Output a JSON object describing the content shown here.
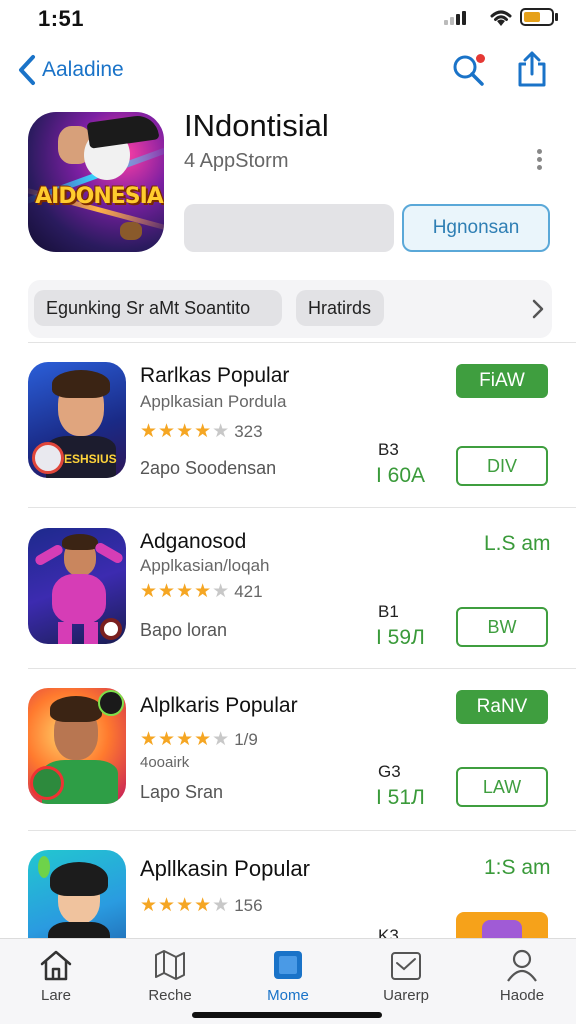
{
  "status_bar": {
    "time": "1:51"
  },
  "nav": {
    "back_label": "Aaladine"
  },
  "hero": {
    "icon_text": "AIDONESIA",
    "title": "INdontisial",
    "subtitle": "4 AppStorm",
    "secondary_button": "Hgnonsan"
  },
  "chips": {
    "items": [
      "Egunking Sr  aMt Soantito",
      "Hratirds"
    ]
  },
  "apps": [
    {
      "name": "Rarlkas Popular",
      "subtitle": "Applkasian Pordula",
      "rating": 4,
      "rating_count": "323",
      "meta": "2apo Soodensan",
      "icon_badge": "ESHSIUS",
      "size_top": "B3",
      "size": "I 60A",
      "top_button": "FiAW",
      "bottom_button": "DIV"
    },
    {
      "name": "Adganosod",
      "subtitle": "Applkasian/loqah",
      "rating": 4,
      "rating_count": "421",
      "meta": "Bapo loran",
      "size_top": "B1",
      "size": "I 59Л",
      "top_label": "L.S am",
      "bottom_button": "BW"
    },
    {
      "name": "Alplkaris Popular",
      "subtitle": "4ooairk",
      "rating": 4,
      "rating_count": "1/9",
      "meta": "Lapo Sran",
      "size_top": "G3",
      "size": "I 51Л",
      "top_button": "RaNV",
      "bottom_button": "LAW"
    },
    {
      "name": "Apllkasin Popular",
      "rating": 4,
      "rating_count": "156",
      "size_top": "K3",
      "top_label": "1:S am"
    }
  ],
  "tabs": [
    {
      "label": "Lare",
      "icon": "home-icon"
    },
    {
      "label": "Reche",
      "icon": "map-icon"
    },
    {
      "label": "Mome",
      "icon": "apps-icon",
      "active": true
    },
    {
      "label": "Uarerp",
      "icon": "mail-icon"
    },
    {
      "label": "Haode",
      "icon": "person-icon"
    }
  ],
  "colors": {
    "accent": "#1a73c8",
    "green": "#3f9e3f",
    "star": "#f5a623"
  }
}
